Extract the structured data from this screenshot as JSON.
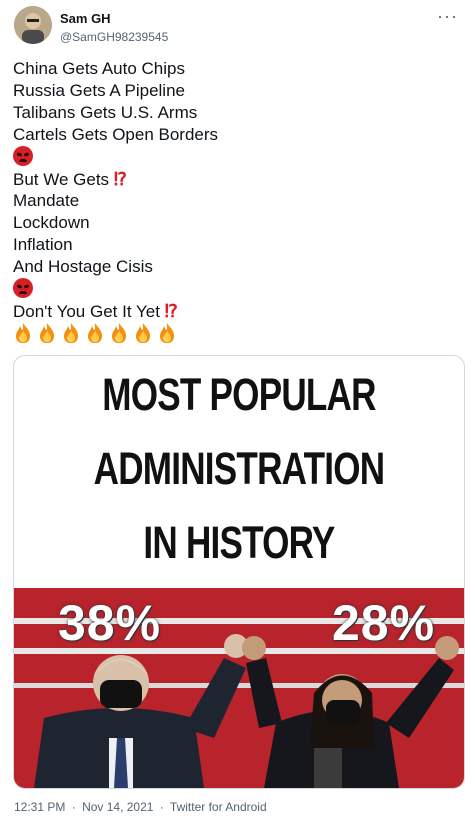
{
  "tweet": {
    "author_name": "Sam GH",
    "author_handle": "@SamGH98239545",
    "more_icon": "more-icon",
    "lines": [
      "China Gets Auto Chips",
      "Russia Gets A Pipeline",
      "Talibans Gets U.S. Arms",
      "Cartels Gets Open Borders",
      "But We Gets",
      "Mandate",
      "Lockdown",
      "Inflation",
      "And Hostage Cisis",
      "Don't You Get It Yet"
    ]
  },
  "media": {
    "title_lines": [
      "MOST POPULAR",
      "ADMINISTRATION",
      "IN HISTORY"
    ],
    "left_percent": "38%",
    "right_percent": "28%"
  },
  "footer": {
    "time": "12:31 PM",
    "date": "Nov 14, 2021",
    "source": "Twitter for Android",
    "separator": "·"
  },
  "colors": {
    "accent_red": "#d81f26",
    "muted": "#536471"
  }
}
